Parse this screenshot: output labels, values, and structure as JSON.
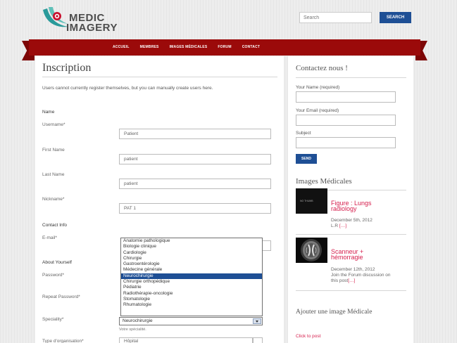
{
  "header": {
    "logo_line1": "MEDIC",
    "logo_line2": "IMAGERY",
    "search_placeholder": "Search",
    "search_button": "SEARCH"
  },
  "nav": {
    "items": [
      "ACCUEIL",
      "MEMBRES",
      "IMAGES MÉDICALES",
      "FORUM",
      "CONTACT"
    ]
  },
  "colors": {
    "brand_red": "#9b0a0a",
    "button_blue": "#1e4f95",
    "link_pink": "#d6204e"
  },
  "main": {
    "title": "Inscription",
    "notice": "Users cannot currently register themselves, but you can manually create users here.",
    "sections": {
      "name": "Name",
      "contact": "Contact Info",
      "about": "About Yourself"
    },
    "labels": {
      "username": "Username*",
      "first_name": "First Name",
      "last_name": "Last Name",
      "nickname": "Nickname*",
      "email": "E-mail*",
      "password": "Password*",
      "repeat_password": "Repeat Password*",
      "speciality": "Speciality*",
      "type": "Type d'organisation*"
    },
    "values": {
      "username": "Patient",
      "first_name": "patient",
      "last_name": "patient",
      "nickname": "PAT 1"
    },
    "speciality_options": [
      "Anatomie pathologique",
      "Biologie clinique",
      "Cardiologie",
      "Chirurgie",
      "Gastroentérologie",
      "Médecine générale",
      "Neurochirurgie",
      "Chirurgie orthopédique",
      "Pédiatrie",
      "Radiothérapie-oncologie",
      "Stomatologie",
      "Rhumatologie"
    ],
    "speciality_highlighted": "Neurochirurgie",
    "speciality_selected": "Neurochirurgie",
    "speciality_hint": "Votre spécialité.",
    "type_value": "Hôpital"
  },
  "sidebar": {
    "contact_title": "Contactez nous !",
    "name_label": "Your Name (required)",
    "email_label": "Your Email (required)",
    "subject_label": "Subject",
    "send_button": "SEND",
    "images_title": "Images Médicales",
    "posts": [
      {
        "thumb_label": "NO THUMB",
        "title_line1": "Figure : Lungs",
        "title_line2": "radiology",
        "date": "December 5th, 2012",
        "excerpt": "L.R",
        "more": "[…]"
      },
      {
        "title_line1": "Scanneur +",
        "title_line2": "hémorragie",
        "date": "December 12th, 2012",
        "excerpt_line1": "Join the Forum discussion on",
        "excerpt_line2": "this post",
        "more": "[…]"
      }
    ],
    "add_image_title": "Ajouter une image Médicale",
    "click_to_post": "Click to post"
  }
}
